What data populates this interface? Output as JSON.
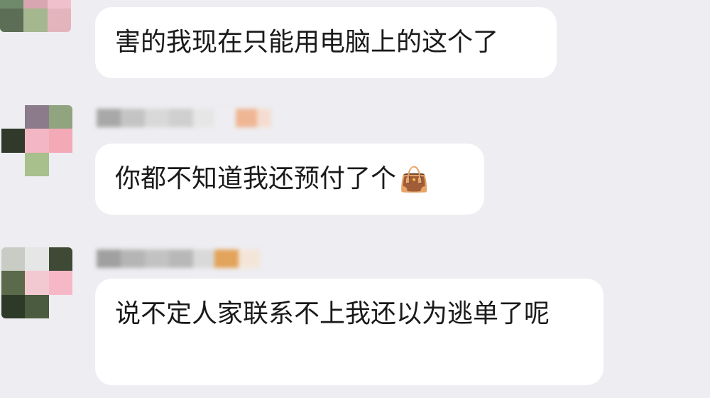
{
  "messages": [
    {
      "text": "害的我现在只能用电脑上的这个了",
      "emoji": ""
    },
    {
      "text": "你都不知道我还预付了个",
      "emoji": "👜"
    },
    {
      "text": "说不定人家联系不上我还以为逃单了呢",
      "emoji": ""
    }
  ],
  "colors": {
    "background": "#eeedf1",
    "bubble": "#ffffff",
    "text": "#1a1a1a"
  }
}
